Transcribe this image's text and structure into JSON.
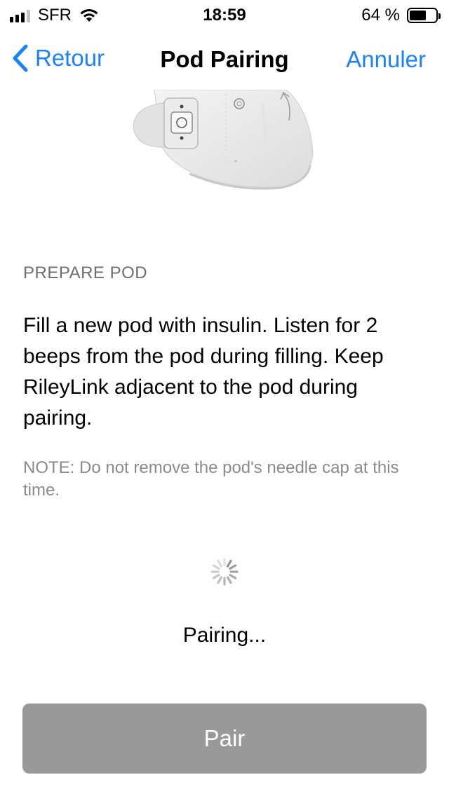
{
  "status_bar": {
    "carrier": "SFR",
    "time": "18:59",
    "battery_percent": "64 %",
    "battery_level": 0.64,
    "signal_bars_filled": 3,
    "signal_bars_total": 4
  },
  "nav": {
    "back_label": "Retour",
    "title": "Pod Pairing",
    "cancel_label": "Annuler"
  },
  "content": {
    "section_header": "PREPARE POD",
    "instructions": "Fill a new pod with insulin. Listen for 2 beeps from the pod during filling. Keep RileyLink adjacent to the pod during pairing.",
    "note": "NOTE: Do not remove the pod's needle cap at this time.",
    "status": "Pairing..."
  },
  "pair_button": {
    "label": "Pair",
    "enabled": false
  },
  "colors": {
    "accent": "#1a82fb",
    "section_header": "#6d6d72",
    "note": "#8a8a8e",
    "button_disabled": "#999999"
  },
  "icons": {
    "back": "chevron-left-icon",
    "wifi": "wifi-icon",
    "battery": "battery-icon",
    "signal": "signal-bars-icon",
    "spinner": "activity-spinner-icon"
  }
}
